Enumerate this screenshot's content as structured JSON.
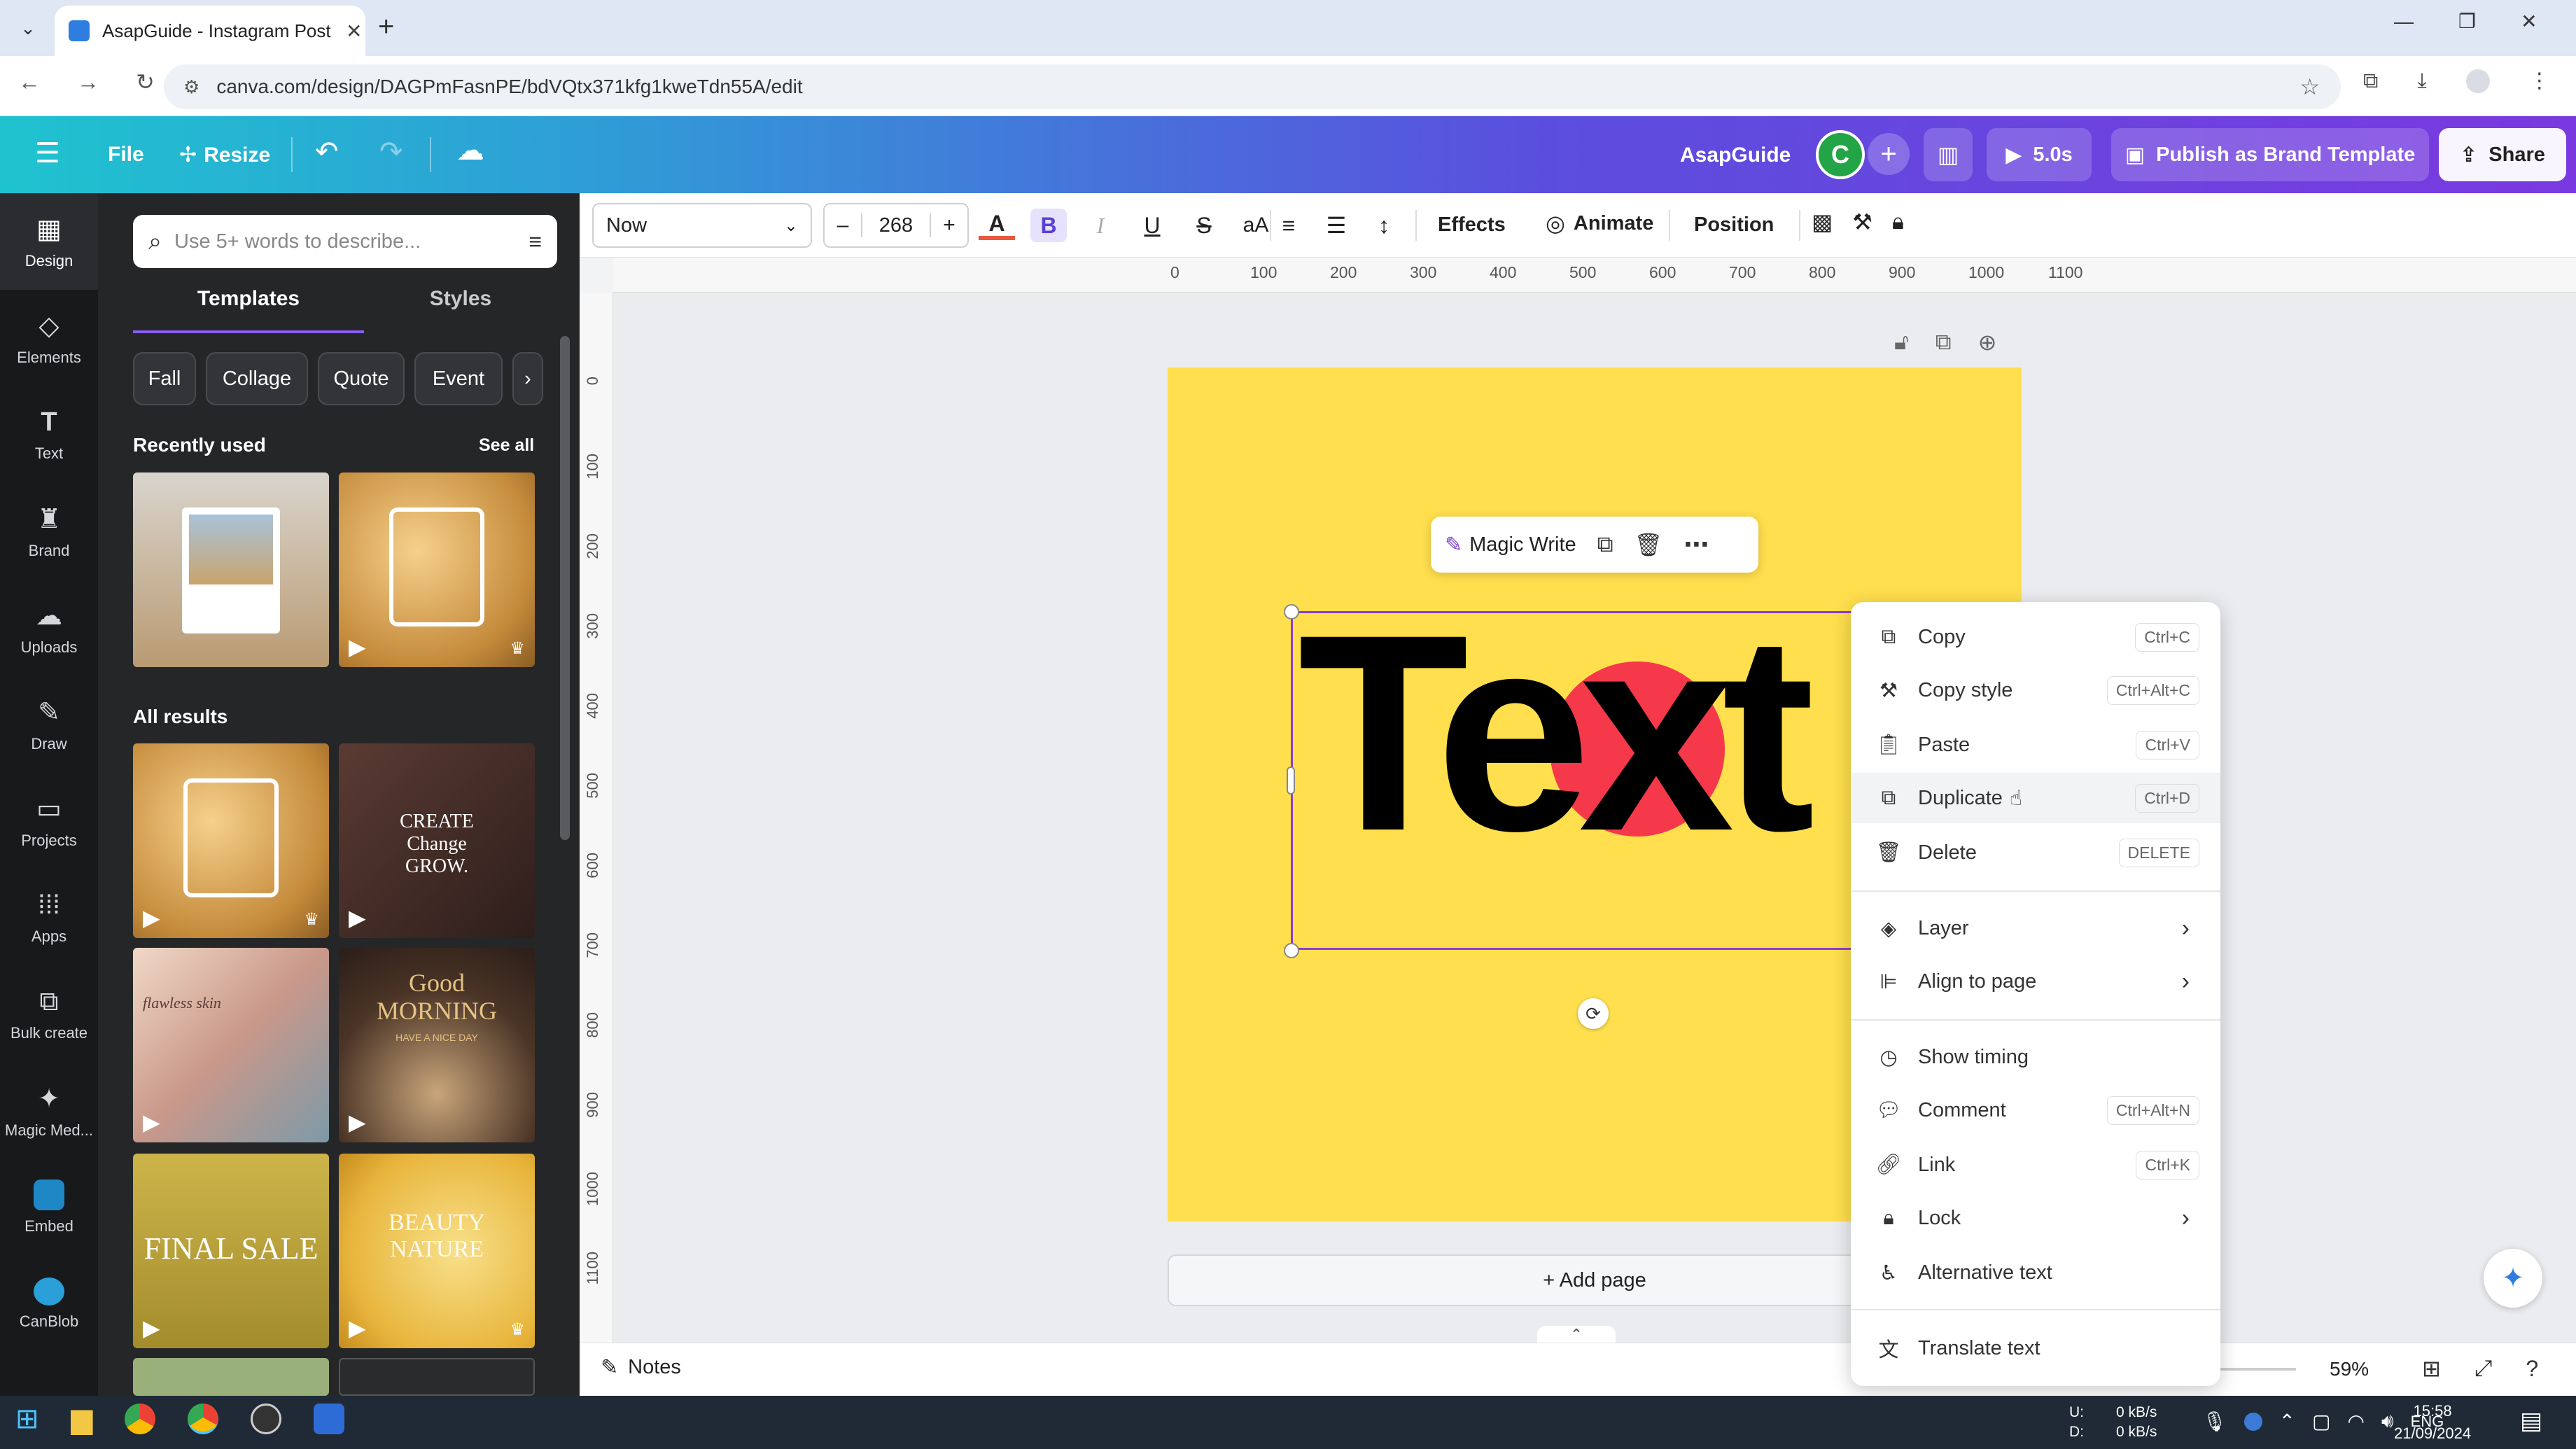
{
  "browser": {
    "tab_title": "AsapGuide - Instagram Post",
    "url": "canva.com/design/DAGPmFasnPE/bdVQtx371kfg1kweTdn55A/edit"
  },
  "header": {
    "file": "File",
    "resize": "Resize",
    "team": "AsapGuide",
    "avatar_letter": "C",
    "timer": "5.0s",
    "publish": "Publish as Brand Template",
    "share": "Share"
  },
  "rail": [
    {
      "label": "Design",
      "icon": "design-icon"
    },
    {
      "label": "Elements",
      "icon": "elements-icon"
    },
    {
      "label": "Text",
      "icon": "text-icon"
    },
    {
      "label": "Brand",
      "icon": "brand-icon"
    },
    {
      "label": "Uploads",
      "icon": "upload-icon"
    },
    {
      "label": "Draw",
      "icon": "draw-icon"
    },
    {
      "label": "Projects",
      "icon": "folder-icon"
    },
    {
      "label": "Apps",
      "icon": "apps-icon"
    },
    {
      "label": "Bulk create",
      "icon": "bulk-create-icon"
    },
    {
      "label": "Magic Med...",
      "icon": "magic-media-icon"
    },
    {
      "label": "Embed",
      "icon": "embed-icon"
    },
    {
      "label": "CanBlob",
      "icon": "canblob-icon"
    }
  ],
  "panel": {
    "search_placeholder": "Use 5+ words to describe...",
    "tab_templates": "Templates",
    "tab_styles": "Styles",
    "chips": [
      "Fall",
      "Collage",
      "Quote",
      "Event"
    ],
    "recently_used": "Recently used",
    "see_all": "See all",
    "all_results": "All results",
    "thumb_texts": {
      "t2": "CREATE\nChange\nGROW.",
      "t4": "Good\nMORNING",
      "t4_sub": "HAVE A NICE DAY",
      "t3": "flawless skin",
      "t5": "FINAL SALE",
      "t6": "BEAUTY\nNATURE"
    }
  },
  "toolbar": {
    "font": "Now",
    "font_size": "268",
    "effects": "Effects",
    "animate": "Animate",
    "position": "Position"
  },
  "ruler_h": [
    "0",
    "100",
    "200",
    "300",
    "400",
    "500",
    "600",
    "700",
    "800",
    "900",
    "1000",
    "1100"
  ],
  "ruler_v": [
    "0",
    "100",
    "200",
    "300",
    "400",
    "500",
    "600",
    "700",
    "800",
    "900",
    "1000",
    "1100"
  ],
  "canvas": {
    "text": "Text",
    "magic_write": "Magic Write",
    "add_page": "+ Add page",
    "page_color": "#ffdf4d",
    "circle_color": "#f5394a"
  },
  "context_menu": [
    {
      "label": "Copy",
      "shortcut": "Ctrl+C",
      "icon": "copy-icon"
    },
    {
      "label": "Copy style",
      "shortcut": "Ctrl+Alt+C",
      "icon": "paint-roller-icon"
    },
    {
      "label": "Paste",
      "shortcut": "Ctrl+V",
      "icon": "clipboard-icon"
    },
    {
      "label": "Duplicate",
      "shortcut": "Ctrl+D",
      "icon": "duplicate-icon"
    },
    {
      "label": "Delete",
      "shortcut": "DELETE",
      "icon": "trash-icon"
    },
    {
      "label": "Layer",
      "icon": "layers-icon"
    },
    {
      "label": "Align to page",
      "icon": "align-icon"
    },
    {
      "label": "Show timing",
      "icon": "clock-icon"
    },
    {
      "label": "Comment",
      "shortcut": "Ctrl+Alt+N",
      "icon": "comment-icon"
    },
    {
      "label": "Link",
      "shortcut": "Ctrl+K",
      "icon": "link-icon"
    },
    {
      "label": "Lock",
      "icon": "lock-icon"
    },
    {
      "label": "Alternative text",
      "icon": "accessibility-icon"
    },
    {
      "label": "Translate text",
      "icon": "translate-icon"
    }
  ],
  "footer": {
    "notes": "Notes",
    "zoom": "59%"
  },
  "taskbar": {
    "net_up": "0 kB/s",
    "net_down": "0 kB/s",
    "lang": "ENG",
    "time": "15:58",
    "date": "21/09/2024",
    "u": "U:",
    "d": "D:"
  }
}
